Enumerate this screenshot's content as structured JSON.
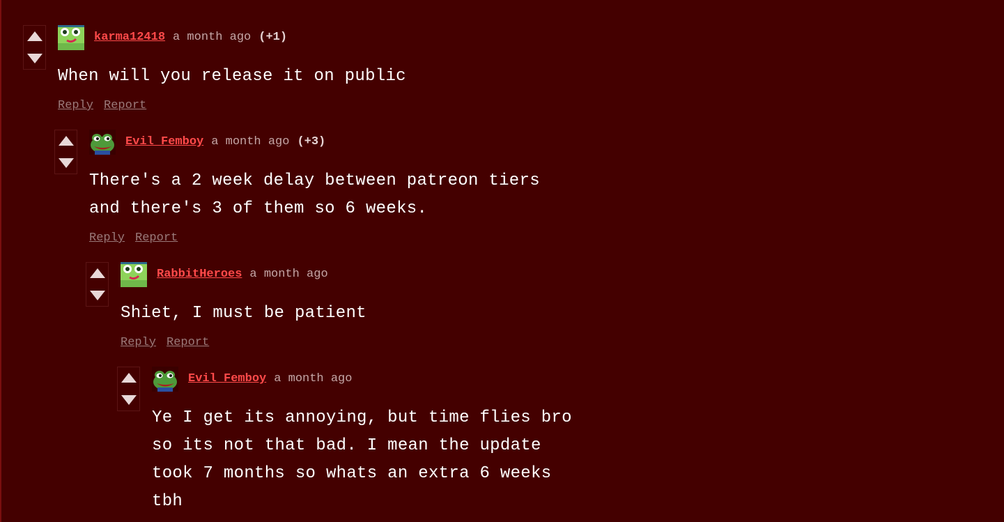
{
  "colors": {
    "background": "#440000",
    "username": "#ff4a4a",
    "timestamp": "#c4a6a6",
    "action_link": "#9a7a7a",
    "vote_arrow": "#e8d8d8"
  },
  "comments": [
    {
      "username": "karma12418",
      "time": "a month ago",
      "points": "(+1)",
      "avatar": "frog-green-avatar-icon",
      "lines": [
        "When will you release it on public"
      ],
      "reply_label": "Reply",
      "report_label": "Report"
    },
    {
      "username": "Evil Femboy",
      "time": "a month ago",
      "points": "(+3)",
      "avatar": "pepe-frog-avatar-icon",
      "lines": [
        "There's a 2 week delay between patreon tiers",
        "and there's 3 of them so 6 weeks."
      ],
      "reply_label": "Reply",
      "report_label": "Report"
    },
    {
      "username": "RabbitHeroes",
      "time": "a month ago",
      "points": "",
      "avatar": "frog-green-avatar-icon",
      "lines": [
        "Shiet, I must be patient"
      ],
      "reply_label": "Reply",
      "report_label": "Report"
    },
    {
      "username": "Evil Femboy",
      "time": "a month ago",
      "points": "",
      "avatar": "pepe-frog-avatar-icon",
      "lines": [
        "Ye I get its annoying, but time flies bro",
        "so its not that bad. I mean the update",
        "took 7 months so whats an extra 6 weeks",
        "tbh"
      ]
    }
  ]
}
